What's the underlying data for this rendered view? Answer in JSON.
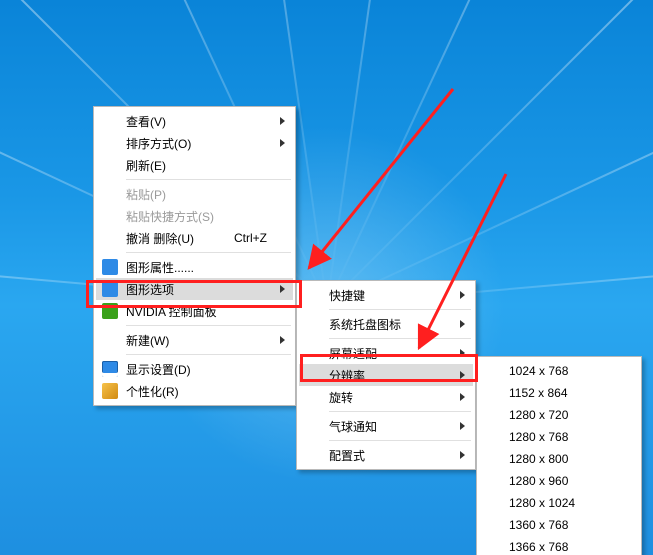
{
  "menu1": {
    "view": "查看(V)",
    "sort": "排序方式(O)",
    "refresh": "刷新(E)",
    "paste": "粘贴(P)",
    "paste_short": "粘贴快捷方式(S)",
    "undo": "撤消 删除(U)",
    "undo_key": "Ctrl+Z",
    "gfx_props": "图形属性......",
    "gfx_opts": "图形选项",
    "nvidia": "NVIDIA 控制面板",
    "new": "新建(W)",
    "display": "显示设置(D)",
    "personalize": "个性化(R)"
  },
  "menu2": {
    "hotkeys": "快捷键",
    "tray": "系统托盘图标",
    "fit": "屏幕适配",
    "res": "分辨率",
    "rotate": "旋转",
    "balloon": "气球通知",
    "profile": "配置式"
  },
  "menu3": {
    "r0": "1024 x 768",
    "r1": "1152 x 864",
    "r2": "1280 x 720",
    "r3": "1280 x 768",
    "r4": "1280 x 800",
    "r5": "1280 x 960",
    "r6": "1280 x 1024",
    "r7": "1360 x 768",
    "r8": "1366 x 768"
  }
}
